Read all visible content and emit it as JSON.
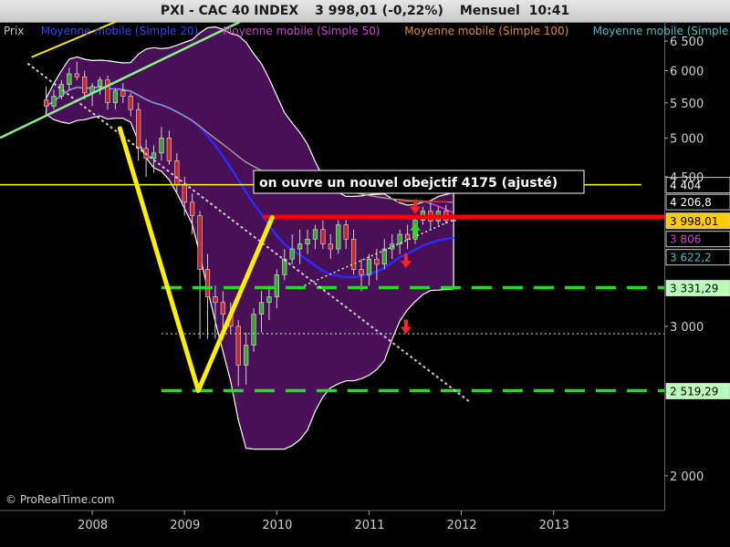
{
  "header": {
    "ticker": "PXI - CAC 40 INDEX",
    "price": "3 998,01 (-0,22%)",
    "interval": "Mensuel",
    "time": "10:41"
  },
  "legend": [
    {
      "label": "Prix",
      "color": "#c8c8c8"
    },
    {
      "label": "Moyenne mobile (Simple 20)",
      "color": "#3b3bff"
    },
    {
      "label": "Moyenne mobile (Simple 50)",
      "color": "#d040d0"
    },
    {
      "label": "Moyenne mobile (Simple 100)",
      "color": "#e08a30"
    },
    {
      "label": "Moyenne mobile (Simple 200)",
      "color": "#40c0c0"
    }
  ],
  "annotation": "on ouvre un nouvel obejctif 4175 (ajusté)",
  "copyright": "© ProRealTime.com",
  "colors": {
    "background": "#000000",
    "bollinger_fill": "#4a1057",
    "price_line": "#ff0000",
    "support": "#22dd22",
    "trend_yellow": "#ffee00"
  },
  "chart_data": {
    "type": "candlestick",
    "scale": "log",
    "ylim": [
      1820,
      6850
    ],
    "xlim": [
      2007.0,
      2014.2
    ],
    "grid": false,
    "legend_position": "top",
    "yticks": [
      6500,
      6000,
      5500,
      5000,
      4500,
      3000,
      2000
    ],
    "ytick_labels": [
      "6 500",
      "6 000",
      "5 500",
      "5 000",
      "4 500",
      "3 000",
      "2 000"
    ],
    "xticks": [
      2008,
      2009,
      2010,
      2011,
      2012,
      2013
    ],
    "xtick_labels": [
      "2008",
      "2009",
      "2010",
      "2011",
      "2012",
      "2013"
    ],
    "candles": [
      [
        5540,
        5750,
        5380,
        5450
      ],
      [
        5450,
        5700,
        5400,
        5600
      ],
      [
        5600,
        5850,
        5550,
        5780
      ],
      [
        5780,
        6050,
        5700,
        5950
      ],
      [
        5950,
        6150,
        5850,
        5900
      ],
      [
        5900,
        6000,
        5550,
        5650
      ],
      [
        5650,
        5800,
        5450,
        5750
      ],
      [
        5750,
        5900,
        5620,
        5850
      ],
      [
        5850,
        5920,
        5400,
        5500
      ],
      [
        5500,
        5720,
        5400,
        5680
      ],
      [
        5680,
        5800,
        5500,
        5600
      ],
      [
        5600,
        5650,
        5300,
        5400
      ],
      [
        5400,
        5500,
        4700,
        4860
      ],
      [
        4860,
        4980,
        4500,
        4730
      ],
      [
        4730,
        4900,
        4550,
        4800
      ],
      [
        4800,
        5150,
        4700,
        5000
      ],
      [
        5000,
        5100,
        4650,
        4700
      ],
      [
        4700,
        4800,
        4300,
        4400
      ],
      [
        4400,
        4500,
        4050,
        4200
      ],
      [
        4200,
        4300,
        3850,
        4050
      ],
      [
        4050,
        4100,
        2900,
        3500
      ],
      [
        3500,
        3650,
        2900,
        3250
      ],
      [
        3250,
        3350,
        2900,
        3200
      ],
      [
        3200,
        3300,
        2900,
        3100
      ],
      [
        3100,
        3200,
        2950,
        3000
      ],
      [
        3000,
        3050,
        2550,
        2700
      ],
      [
        2700,
        2950,
        2560,
        2850
      ],
      [
        2850,
        3150,
        2800,
        3100
      ],
      [
        3100,
        3300,
        2950,
        3200
      ],
      [
        3200,
        3350,
        3050,
        3250
      ],
      [
        3250,
        3500,
        3150,
        3450
      ],
      [
        3450,
        3700,
        3400,
        3600
      ],
      [
        3600,
        3850,
        3550,
        3700
      ],
      [
        3700,
        3900,
        3550,
        3750
      ],
      [
        3750,
        3900,
        3650,
        3800
      ],
      [
        3800,
        3950,
        3700,
        3900
      ],
      [
        3900,
        4000,
        3700,
        3750
      ],
      [
        3750,
        3850,
        3600,
        3700
      ],
      [
        3700,
        4000,
        3650,
        3950
      ],
      [
        3950,
        4000,
        3700,
        3800
      ],
      [
        3800,
        3900,
        3450,
        3500
      ],
      [
        3500,
        3600,
        3300,
        3450
      ],
      [
        3450,
        3650,
        3350,
        3600
      ],
      [
        3600,
        3700,
        3400,
        3550
      ],
      [
        3550,
        3800,
        3500,
        3700
      ],
      [
        3700,
        3850,
        3600,
        3750
      ],
      [
        3750,
        3900,
        3650,
        3850
      ],
      [
        3850,
        3950,
        3700,
        3800
      ],
      [
        3800,
        4050,
        3750,
        4000
      ],
      [
        4000,
        4150,
        3950,
        4100
      ],
      [
        4100,
        4200,
        3900,
        3990
      ],
      [
        3990,
        4150,
        3950,
        4100
      ],
      [
        4100,
        4170,
        3960,
        4000
      ],
      [
        4000,
        4100,
        3950,
        3998.01
      ]
    ],
    "candle_start_year": 2007.5,
    "horizontal_levels": [
      {
        "value": 4404,
        "label": "4 404",
        "color": "#ffff00",
        "style": "solid",
        "box_color": "#000000",
        "text_color": "#ffffff"
      },
      {
        "value": 4206.8,
        "label": "4 206,8",
        "color": "#dd2222",
        "style": "solid",
        "box_color": "#000000",
        "text_color": "#ffffff"
      },
      {
        "value": 4035,
        "label": "",
        "color": "#ff0000",
        "style": "thick",
        "box_color": "#ff4444",
        "text_color": "#000000"
      },
      {
        "value": 3998.01,
        "label": "3 998,01",
        "color": "#ffcc00",
        "style": "none",
        "box_color": "#ffcc00",
        "text_color": "#000000"
      },
      {
        "value": 3806,
        "label": "3 806",
        "color": "#3b3bff",
        "style": "none",
        "box_color": "#000000",
        "text_color": "#d040d0"
      },
      {
        "value": 3622.2,
        "label": "3 622,2",
        "color": "#40c0c0",
        "style": "none",
        "box_color": "#000000",
        "text_color": "#40c0c0"
      },
      {
        "value": 3331.29,
        "label": "3 331,29",
        "color": "#22dd22",
        "style": "dashed",
        "box_color": "#b8ffb8",
        "text_color": "#000000"
      },
      {
        "value": 2940,
        "label": "",
        "color": "#b8ffb8",
        "style": "dotted",
        "box_color": "",
        "text_color": ""
      },
      {
        "value": 2519.29,
        "label": "2 519,29",
        "color": "#22dd22",
        "style": "dashed",
        "box_color": "#b8ffb8",
        "text_color": "#000000"
      }
    ],
    "yellow_trendlines": [
      {
        "from": [
          2007.35,
          6230
        ],
        "to": [
          2008.25,
          6850
        ]
      },
      {
        "from": [
          2008.3,
          5130
        ],
        "to": [
          2009.15,
          2520
        ]
      },
      {
        "from": [
          2009.15,
          2520
        ],
        "to": [
          2009.95,
          4030
        ]
      }
    ],
    "green_channel": {
      "from": [
        2007.0,
        5000
      ],
      "to": [
        2009.6,
        6850
      ]
    },
    "dotted_downtrend": {
      "from": [
        2007.3,
        6120
      ],
      "to": [
        2012.1,
        2440
      ]
    },
    "dotted_uptrend": {
      "from": [
        2010.3,
        3350
      ],
      "to": [
        2011.9,
        4000
      ]
    },
    "arrows": [
      {
        "x": 2011.5,
        "y": 4404,
        "dir": "up",
        "color": "#22dd22"
      },
      {
        "x": 2011.5,
        "y": 4170,
        "dir": "down",
        "color": "#ff2222"
      },
      {
        "x": 2011.5,
        "y": 3870,
        "dir": "up",
        "color": "#22dd22"
      },
      {
        "x": 2011.4,
        "y": 3600,
        "dir": "down",
        "color": "#ff2222"
      },
      {
        "x": 2011.4,
        "y": 3010,
        "dir": "down",
        "color": "#ff2222"
      }
    ]
  }
}
